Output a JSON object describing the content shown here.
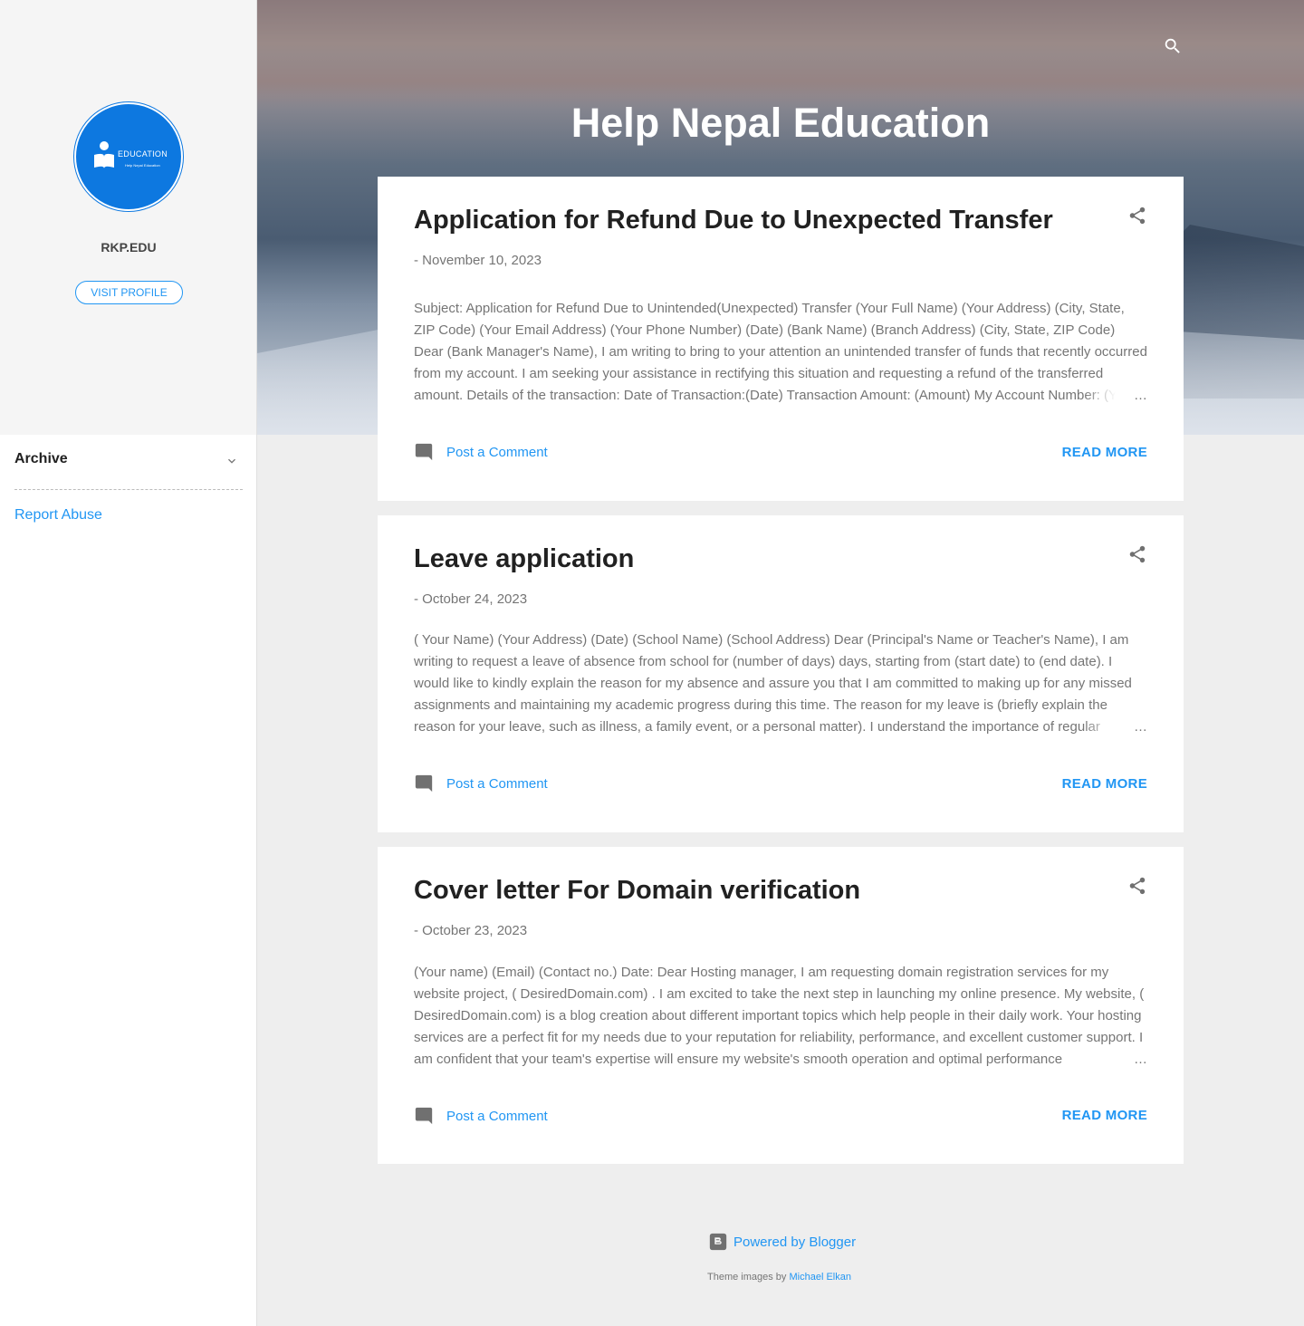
{
  "sidebar": {
    "avatar_word": "EDUCATION",
    "avatar_sub": "Help Nepal Education",
    "profile_name": "RKP.EDU",
    "visit_profile_label": "VISIT PROFILE",
    "archive_label": "Archive",
    "report_abuse_label": "Report Abuse"
  },
  "header": {
    "blog_title": "Help Nepal Education"
  },
  "posts": [
    {
      "title": "Application for Refund Due to Unexpected Transfer",
      "date_prefix": "-",
      "date": "November 10, 2023",
      "snippet": "  Subject: Application for Refund Due to Unintended(Unexpected) Transfer (Your Full Name) (Your Address)  (City, State, ZIP Code) (Your Email Address) (Your Phone Number) (Date) (Bank Name) (Branch Address) (City, State, ZIP Code) Dear (Bank Manager's Name), I am writing to bring to your attention an unintended transfer of funds that recently occurred from my account. I am seeking your assistance in rectifying this situation and requesting a refund of the transferred amount. Details of the transaction: Date of Transaction:(Date) Transaction Amount: (Amount) My Account Number: (Y",
      "comment_label": "Post a Comment",
      "read_more_label": "READ MORE"
    },
    {
      "title": "Leave application",
      "date_prefix": "-",
      "date": "October 24, 2023",
      "snippet": " ( Your Name) (Your Address) (Date) (School Name) (School Address) Dear (Principal's Name or Teacher's Name), I am writing to request a leave of absence from school for (number of days) days, starting from (start date) to (end date). I would like to kindly explain the reason for my absence and assure you that I am committed to making up for any missed assignments and maintaining my academic progress during this time. The reason for my leave is (briefly explain the reason for your leave, such as illness, a family event, or a personal matter). I understand the importance of regular",
      "comment_label": "Post a Comment",
      "read_more_label": "READ MORE"
    },
    {
      "title": "Cover letter For Domain verification",
      "date_prefix": "-",
      "date": "October 23, 2023",
      "snippet": "(Your name) (Email) (Contact no.) Date:  Dear Hosting manager, I am requesting domain registration services for my website project, ( DesiredDomain.com) . I am excited to take the next step in launching my online presence. My website, ( DesiredDomain.com)   is a blog creation about different important topics which help people in their daily work. Your hosting services are a perfect fit for my needs due to your reputation for reliability, performance, and excellent customer support. I am confident that your team's expertise will ensure my website's smooth operation and optimal performance",
      "comment_label": "Post a Comment",
      "read_more_label": "READ MORE"
    }
  ],
  "ellipsis": "…",
  "footer": {
    "powered_label": "Powered by Blogger",
    "theme_prefix": "Theme images by",
    "theme_author": "Michael Elkan"
  },
  "colors": {
    "accent": "#2196f3",
    "avatar_bg": "#0d78e0",
    "page_bg": "#eeeeee"
  },
  "icons": [
    "search-icon",
    "share-icon",
    "comment-icon",
    "chevron-down-icon",
    "blogger-icon",
    "person-book-icon"
  ]
}
